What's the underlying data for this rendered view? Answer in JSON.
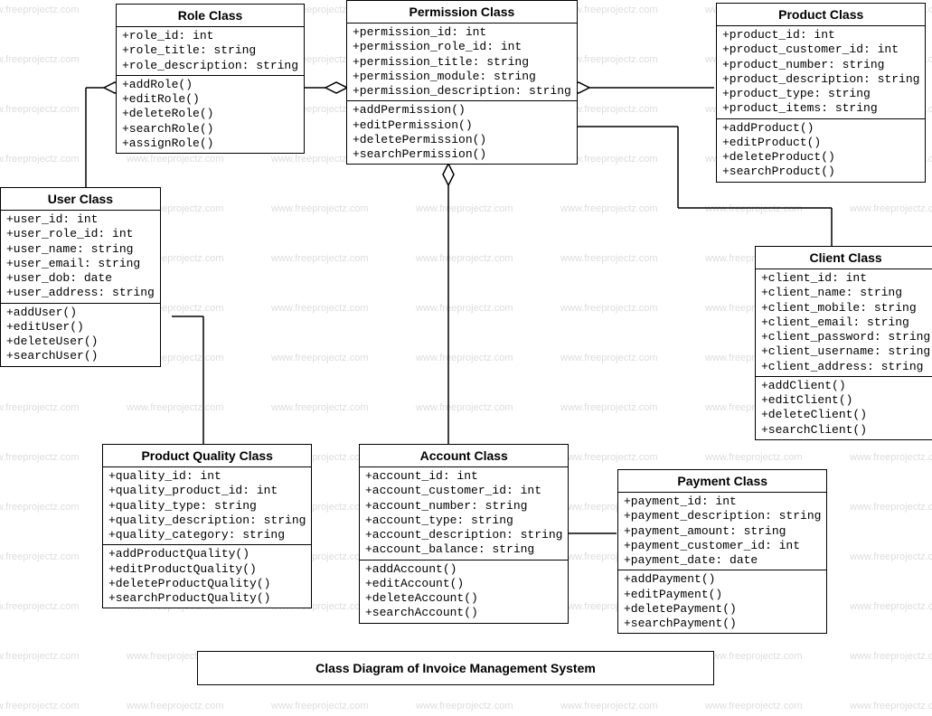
{
  "diagram_title": "Class Diagram of Invoice Management System",
  "watermark_text": "www.freeprojectz.com",
  "classes": {
    "role": {
      "title": "Role Class",
      "attrs": [
        "+role_id: int",
        "+role_title: string",
        "+role_description: string"
      ],
      "ops": [
        "+addRole()",
        "+editRole()",
        "+deleteRole()",
        "+searchRole()",
        "+assignRole()"
      ]
    },
    "permission": {
      "title": "Permission Class",
      "attrs": [
        "+permission_id: int",
        "+permission_role_id: int",
        "+permission_title: string",
        "+permission_module: string",
        "+permission_description: string"
      ],
      "ops": [
        "+addPermission()",
        "+editPermission()",
        "+deletePermission()",
        "+searchPermission()"
      ]
    },
    "product": {
      "title": "Product Class",
      "attrs": [
        "+product_id: int",
        "+product_customer_id: int",
        "+product_number: string",
        "+product_description: string",
        "+product_type: string",
        "+product_items: string"
      ],
      "ops": [
        "+addProduct()",
        "+editProduct()",
        "+deleteProduct()",
        "+searchProduct()"
      ]
    },
    "user": {
      "title": "User Class",
      "attrs": [
        "+user_id: int",
        "+user_role_id: int",
        "+user_name: string",
        "+user_email: string",
        "+user_dob: date",
        "+user_address: string"
      ],
      "ops": [
        "+addUser()",
        "+editUser()",
        "+deleteUser()",
        "+searchUser()"
      ]
    },
    "client": {
      "title": "Client Class",
      "attrs": [
        "+client_id: int",
        "+client_name: string",
        "+client_mobile: string",
        "+client_email: string",
        "+client_password: string",
        "+client_username: string",
        "+client_address: string"
      ],
      "ops": [
        "+addClient()",
        "+editClient()",
        "+deleteClient()",
        "+searchClient()"
      ]
    },
    "productQuality": {
      "title": "Product Quality Class",
      "attrs": [
        "+quality_id: int",
        "+quality_product_id: int",
        "+quality_type: string",
        "+quality_description: string",
        "+quality_category: string"
      ],
      "ops": [
        "+addProductQuality()",
        "+editProductQuality()",
        "+deleteProductQuality()",
        "+searchProductQuality()"
      ]
    },
    "account": {
      "title": "Account Class",
      "attrs": [
        "+account_id: int",
        "+account_customer_id: int",
        "+account_number: string",
        "+account_type: string",
        "+account_description: string",
        "+account_balance: string"
      ],
      "ops": [
        "+addAccount()",
        "+editAccount()",
        "+deleteAccount()",
        "+searchAccount()"
      ]
    },
    "payment": {
      "title": "Payment Class",
      "attrs": [
        "+payment_id: int",
        "+payment_description: string",
        "+payment_amount: string",
        "+payment_customer_id: int",
        "+payment_date: date"
      ],
      "ops": [
        "+addPayment()",
        "+editPayment()",
        "+deletePayment()",
        "+searchPayment()"
      ]
    }
  }
}
